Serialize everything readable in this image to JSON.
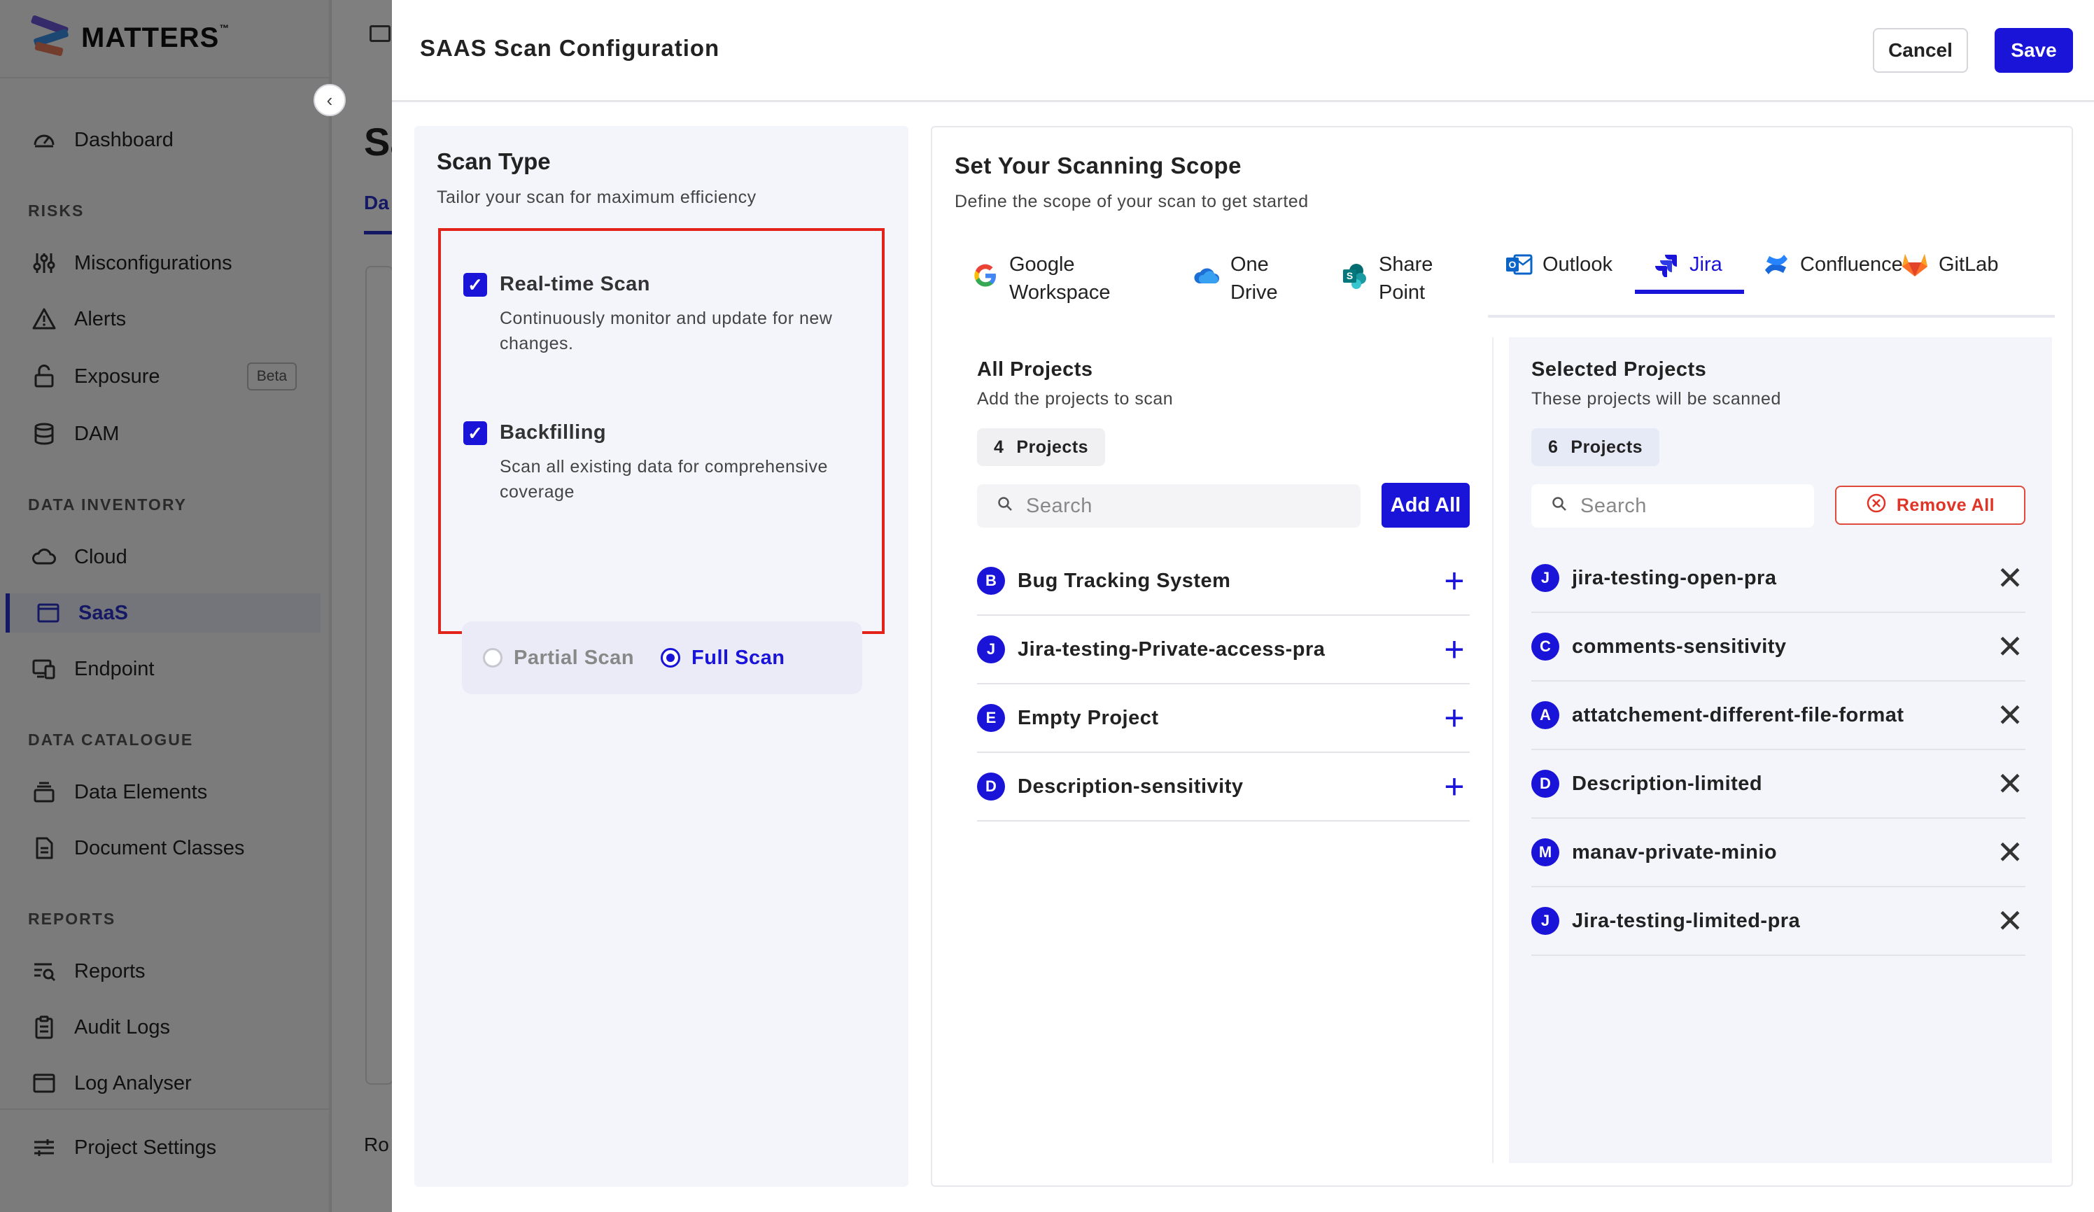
{
  "app": {
    "brand": "MATTERS",
    "brand_tm": "™",
    "page_title": "Sa",
    "bg_tab": "Da",
    "bg_rows": "Ro"
  },
  "sidebar": {
    "dashboard": "Dashboard",
    "risks_header": "RISKS",
    "misconfigurations": "Misconfigurations",
    "alerts": "Alerts",
    "exposure": "Exposure",
    "exposure_badge": "Beta",
    "dam": "DAM",
    "data_inventory_header": "DATA INVENTORY",
    "cloud": "Cloud",
    "saas": "SaaS",
    "endpoint": "Endpoint",
    "data_catalogue_header": "DATA CATALOGUE",
    "data_elements": "Data Elements",
    "document_classes": "Document Classes",
    "reports_header": "REPORTS",
    "reports": "Reports",
    "audit_logs": "Audit Logs",
    "log_analyser": "Log Analyser",
    "project_settings": "Project Settings"
  },
  "modal": {
    "title": "SAAS Scan Configuration",
    "cancel_label": "Cancel",
    "save_label": "Save"
  },
  "scan_type": {
    "title": "Scan Type",
    "subtitle": "Tailor your scan for maximum efficiency",
    "realtime": {
      "label": "Real-time Scan",
      "description": "Continuously monitor and update for new changes.",
      "checked": true
    },
    "backfilling": {
      "label": "Backfilling",
      "description": "Scan all existing data for comprehensive coverage",
      "checked": true
    },
    "partial_label": "Partial Scan",
    "full_label": "Full Scan",
    "selected_mode": "Full Scan"
  },
  "scope": {
    "title": "Set Your Scanning Scope",
    "subtitle": "Define the scope of your scan to get started",
    "sources": {
      "google_line1": "Google",
      "google_line2": "Workspace",
      "onedrive_line1": "One",
      "onedrive_line2": "Drive",
      "sharepoint_line1": "Share",
      "sharepoint_line2": "Point",
      "outlook": "Outlook",
      "jira": "Jira",
      "confluence": "Confluence",
      "gitlab": "GitLab"
    },
    "active_source": "Jira",
    "accent_color": "#1a14d9"
  },
  "all_projects": {
    "title": "All Projects",
    "subtitle": "Add the projects to scan",
    "count": "4",
    "count_label": "Projects",
    "search_placeholder": "Search",
    "add_all_label": "Add All",
    "items": [
      {
        "initial": "B",
        "name": "Bug Tracking System"
      },
      {
        "initial": "J",
        "name": "Jira-testing-Private-access-pra"
      },
      {
        "initial": "E",
        "name": "Empty Project"
      },
      {
        "initial": "D",
        "name": "Description-sensitivity"
      }
    ]
  },
  "selected_projects": {
    "title": "Selected Projects",
    "subtitle": "These projects will be scanned",
    "count": "6",
    "count_label": "Projects",
    "search_placeholder": "Search",
    "remove_all_label": "Remove All",
    "items": [
      {
        "initial": "J",
        "name": "jira-testing-open-pra"
      },
      {
        "initial": "C",
        "name": "comments-sensitivity"
      },
      {
        "initial": "A",
        "name": "attatchement-different-file-format"
      },
      {
        "initial": "D",
        "name": "Description-limited"
      },
      {
        "initial": "M",
        "name": "manav-private-minio"
      },
      {
        "initial": "J",
        "name": "Jira-testing-limited-pra"
      }
    ]
  }
}
